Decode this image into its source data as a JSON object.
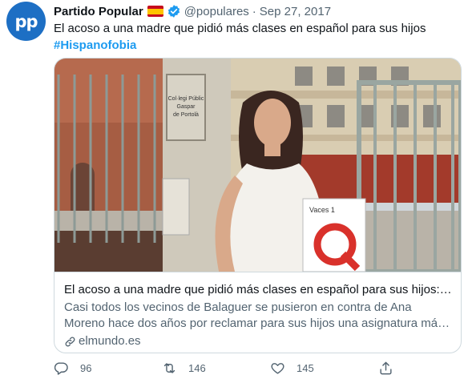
{
  "tweet": {
    "avatar_text": "pp",
    "author_name": "Partido Popular",
    "handle": "@populares",
    "separator": "·",
    "date": "Sep 27, 2017",
    "text": "El acoso a una madre que pidió más clases en español para sus hijos",
    "hashtag": "#Hispanofobia",
    "flag_icon": "spain-flag-icon",
    "verified_icon": "verified-badge-icon"
  },
  "card": {
    "image_desc_icon": "photo",
    "book_title": "Vaces 1",
    "school_sign_lines": [
      "Col·legi Públic",
      "Gaspar",
      "de Portolà"
    ],
    "title": "El acoso a una madre que pidió más clases en español para sus hijos: \"Ningún profesor...",
    "description": "Casi todos los vecinos de Balaguer se pusieron en contra de Ana Moreno hace dos años por reclamar para sus hijos una asignatura más en castellano",
    "domain": "elmundo.es"
  },
  "actions": {
    "replies": "96",
    "retweets": "146",
    "likes": "145"
  },
  "colors": {
    "link": "#1d9bf0",
    "secondary": "#536471",
    "avatar_bg": "#1d6fc4"
  }
}
